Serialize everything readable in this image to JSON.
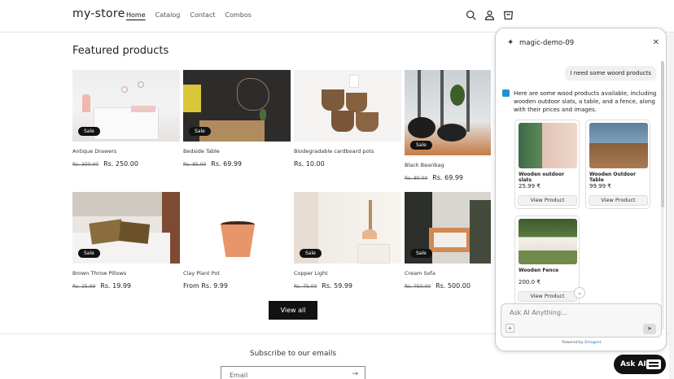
{
  "header": {
    "logo": "my-store",
    "nav": [
      "Home",
      "Catalog",
      "Contact",
      "Combos"
    ]
  },
  "section_title": "Featured products",
  "products": [
    {
      "name": "Antique Drawers",
      "old": "Rs. 300.00",
      "price": "Rs. 250.00",
      "sale": "Sale"
    },
    {
      "name": "Bedside Table",
      "old": "Rs. 85.00",
      "price": "Rs. 69.99",
      "sale": "Sale"
    },
    {
      "name": "Biodegradable cardboard pots",
      "old": "",
      "price": "Rs. 10.00",
      "sale": ""
    },
    {
      "name": "Black Beanbag",
      "old": "Rs. 80.00",
      "price": "Rs. 69.99",
      "sale": "Sale"
    },
    {
      "name": "Brown Throw Pillows",
      "old": "Rs. 25.99",
      "price": "Rs. 19.99",
      "sale": "Sale"
    },
    {
      "name": "Clay Plant Pot",
      "old": "",
      "price": "From Rs. 9.99",
      "sale": ""
    },
    {
      "name": "Copper Light",
      "old": "Rs. 75.00",
      "price": "Rs. 59.99",
      "sale": "Sale"
    },
    {
      "name": "Cream Sofa",
      "old": "Rs. 750.00",
      "price": "Rs. 500.00",
      "sale": "Sale"
    }
  ],
  "view_all": "View all",
  "subscribe": "Subscribe to our emails",
  "email_placeholder": "Email",
  "chat": {
    "title": "magic-demo-09",
    "user_message": "I need some woord products",
    "bot_message": "Here are some wood products available, including wooden outdoor slats, a table, and a fence, along with their prices and images.",
    "cards": [
      {
        "name": "Wooden outdoor slats",
        "price": "25.99 ₹",
        "button": "View Product"
      },
      {
        "name": "Wooden Outdoor Table",
        "price": "99.99 ₹",
        "button": "View Product"
      },
      {
        "name": "Wooden Fence",
        "price": "200.0 ₹",
        "button": "View Product"
      }
    ],
    "input_placeholder": "Ask AI Anything...",
    "powered_by": "Powered by",
    "powered_brand": "Zerogent"
  },
  "ask_ai": "Ask AI"
}
